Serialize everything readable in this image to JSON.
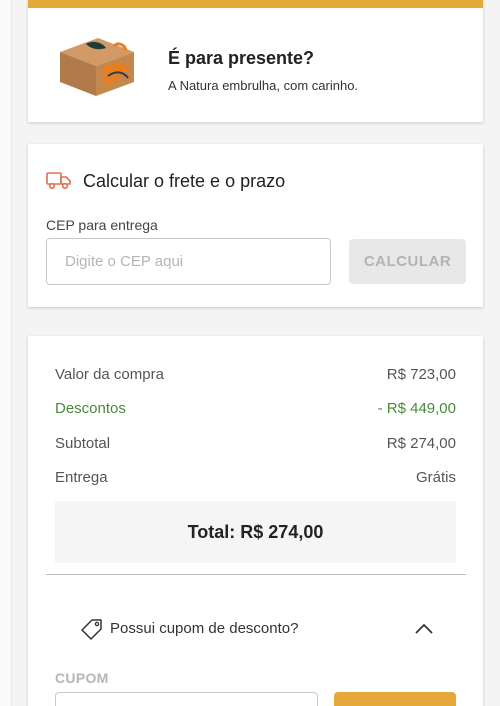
{
  "gift": {
    "title": "É para presente?",
    "subtitle": "A Natura embrulha, com carinho."
  },
  "shipping": {
    "title": "Calcular o frete e o prazo",
    "cep_label": "CEP para entrega",
    "cep_placeholder": "Digite o CEP aqui",
    "cep_value": "",
    "calc_label": "CALCULAR"
  },
  "summary": {
    "rows": [
      {
        "label": "Valor da compra",
        "value": "R$ 723,00"
      },
      {
        "label": "Descontos",
        "value": "- R$ 449,00"
      },
      {
        "label": "Subtotal",
        "value": "R$ 274,00"
      },
      {
        "label": "Entrega",
        "value": "Grátis"
      }
    ],
    "total": "Total: R$ 274,00"
  },
  "coupon": {
    "question": "Possui cupom de desconto?",
    "label": "CUPOM",
    "value": ""
  },
  "colors": {
    "accent": "#e5a93b",
    "discount": "#4a8a3a",
    "truck_icon": "#e0704a"
  },
  "icons": {
    "gift_box": "gift-box-image",
    "truck": "truck-icon",
    "tag": "tag-icon",
    "chevron": "chevron-up-icon"
  }
}
